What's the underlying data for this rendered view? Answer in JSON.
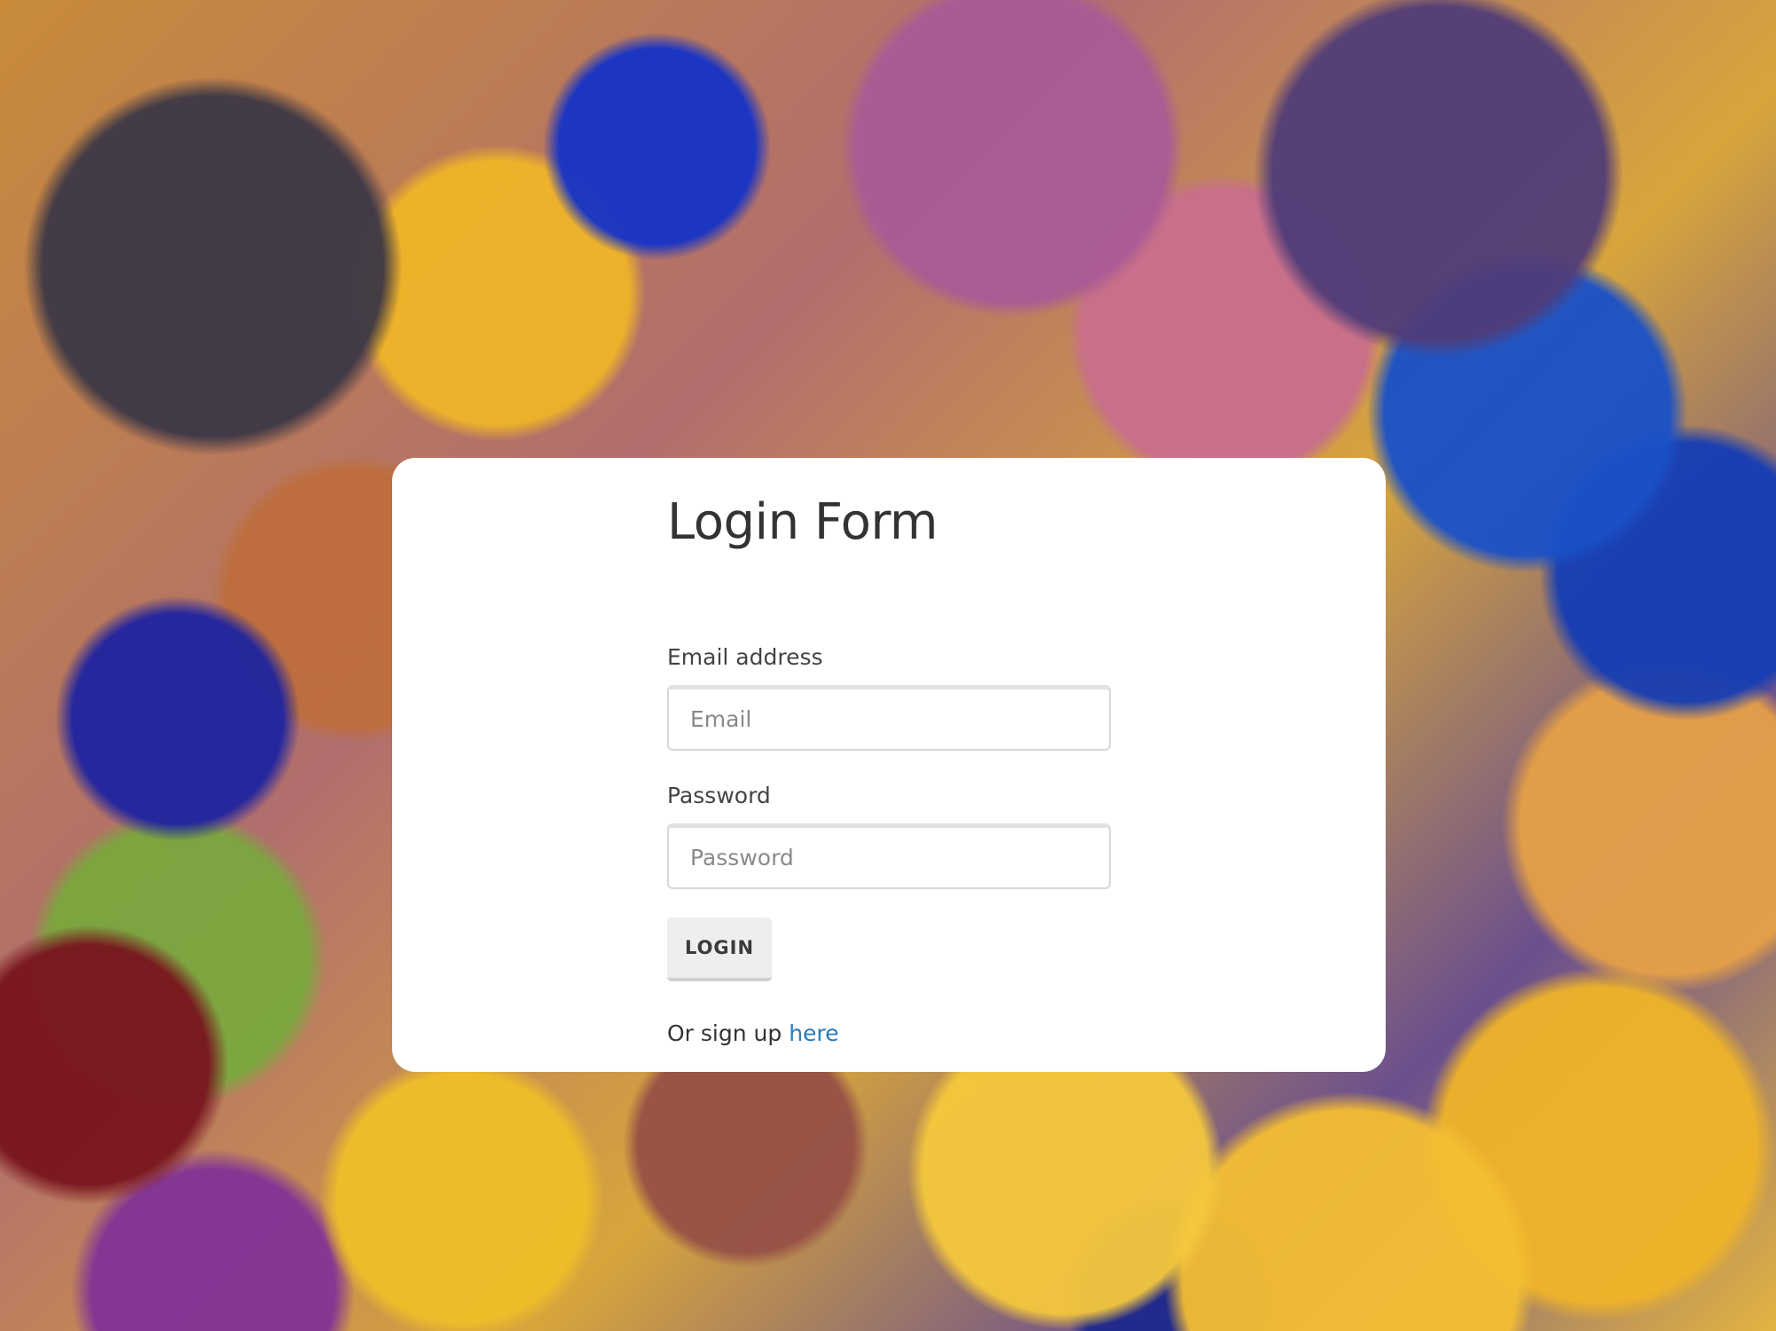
{
  "form": {
    "title": "Login Form",
    "email_label": "Email address",
    "email_placeholder": "Email",
    "email_value": "",
    "password_label": "Password",
    "password_placeholder": "Password",
    "password_value": "",
    "login_label": "LOGIN",
    "signup_prefix": "Or sign up",
    "signup_link_label": "here"
  },
  "colors": {
    "card_background": "#ffffff",
    "link": "#2a7ab8",
    "button_background": "#eeeeee",
    "text": "#333333"
  }
}
